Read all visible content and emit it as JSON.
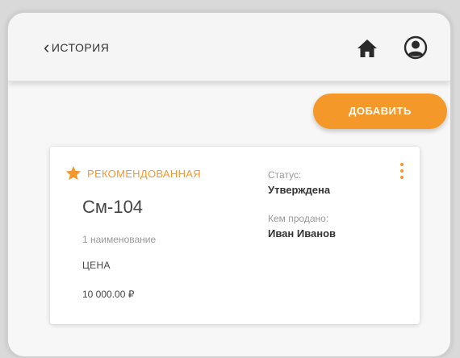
{
  "header": {
    "back_label": "ИСТОРИЯ",
    "icons": {
      "back": "chevron-left-icon",
      "home": "home-icon",
      "account": "account-circle-icon"
    }
  },
  "actions": {
    "add_label": "ДОБАВИТЬ"
  },
  "card": {
    "recommended_label": "РЕКОМЕНДОВАННАЯ",
    "product_name": "См-104",
    "items_count": "1 наименование",
    "price_label": "ЦЕНА",
    "price_value": "10 000.00 ₽",
    "status_label": "Статус:",
    "status_value": "Утверждена",
    "sold_by_label": "Кем продано:",
    "sold_by_value": "Иван Иванов"
  },
  "colors": {
    "accent": "#f5982a",
    "text": "#333333",
    "muted": "#999999",
    "background": "#f7f7f7"
  }
}
